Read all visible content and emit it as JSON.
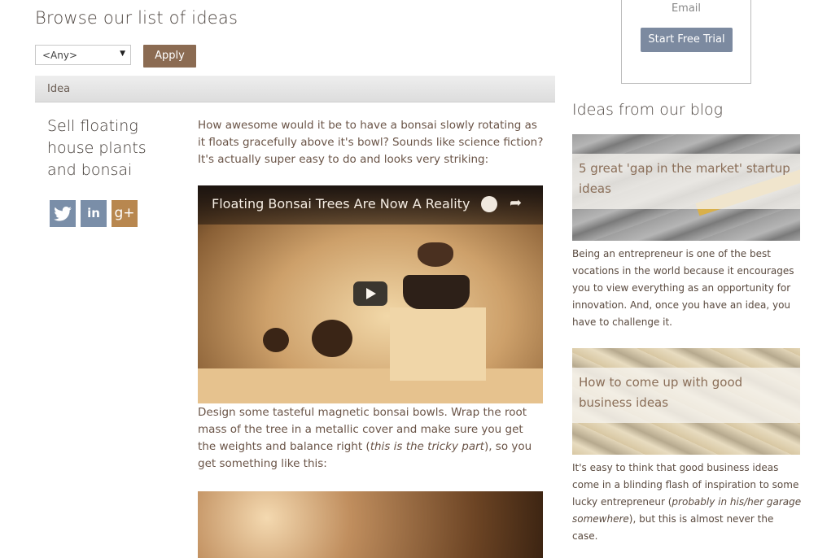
{
  "page": {
    "heading": "Browse our list of ideas"
  },
  "filter": {
    "selected": "<Any>",
    "apply_label": "Apply"
  },
  "table": {
    "column_header": "Idea"
  },
  "idea": {
    "title": "Sell floating house plants and bonsai",
    "social": [
      {
        "name": "twitter",
        "glyph": "🐦"
      },
      {
        "name": "linkedin",
        "glyph": "in"
      },
      {
        "name": "google-plus",
        "glyph": "g+"
      }
    ],
    "intro": "How awesome would it be to have a bonsai slowly rotating as it floats gracefully above it's bowl? Sounds like science fiction? It's actually super easy to do and looks very striking:",
    "video_title": "Floating Bonsai Trees Are Now A Reality",
    "para2_a": "Design some tasteful magnetic bonsai bowls. Wrap the root mass of the tree in a metallic cover and make sure you get the weights and balance right (",
    "para2_em": "this is the tricky part",
    "para2_b": "), so you get something like this:"
  },
  "trial": {
    "email_label": "Email",
    "button_label": "Start Free Trial"
  },
  "blog": {
    "heading": "Ideas from our blog",
    "posts": [
      {
        "title": "5 great 'gap in the market' startup ideas",
        "excerpt": "Being an entrepreneur is one of the best vocations in the world because it encourages you to view everything as an opportunity for innovation. And, once you have an idea, you have to challenge it."
      },
      {
        "title": "How to come up with good business ideas",
        "excerpt_a": "It's easy to think that good business ideas come in a blinding flash of inspiration to some lucky entrepreneur (",
        "excerpt_em": "probably in his/her garage somewhere",
        "excerpt_b": "), but this is almost never the case."
      }
    ]
  },
  "colors": {
    "apply_button": "#8b6b52",
    "trial_button": "#7c8aa0",
    "social_blue": "#7a8ea8",
    "google_plus": "#b8874f"
  }
}
